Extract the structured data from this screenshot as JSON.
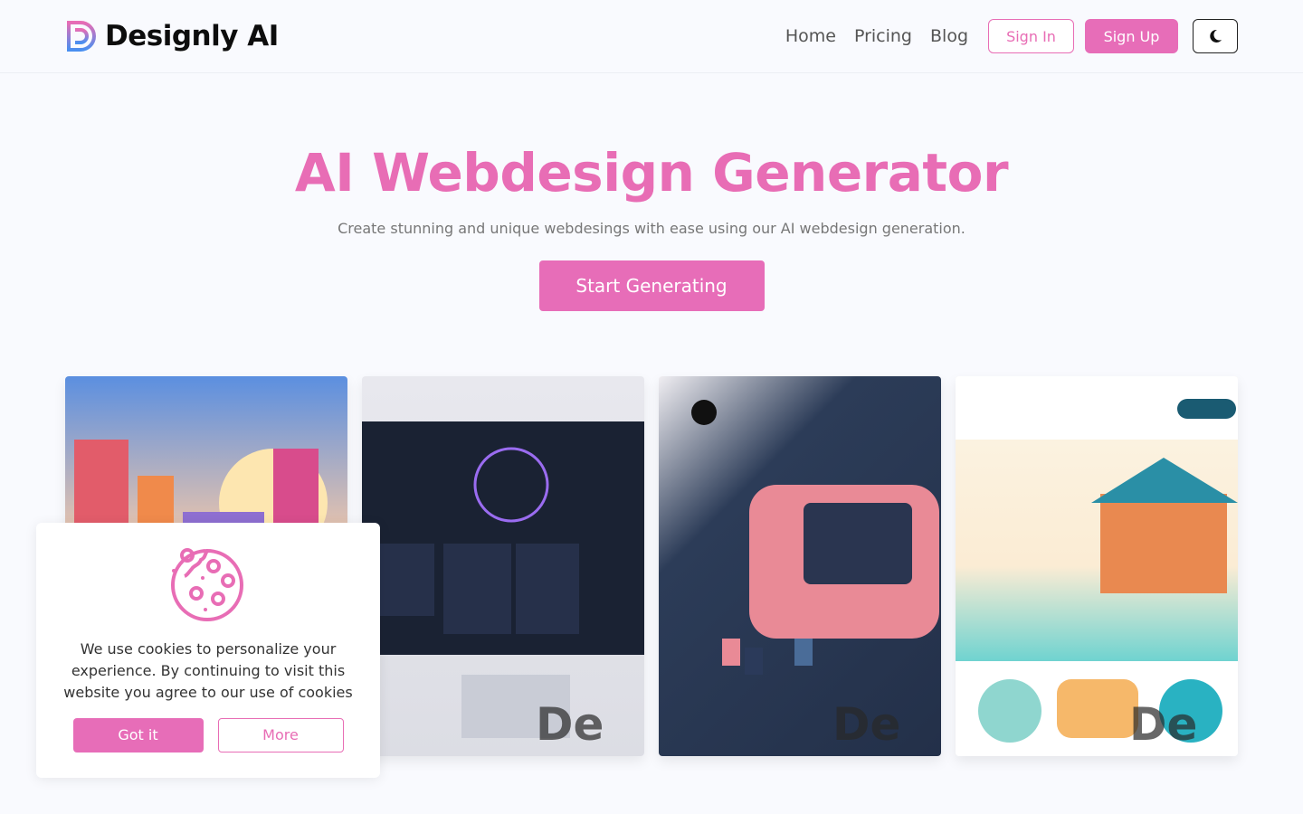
{
  "brand": {
    "name": "Designly AI",
    "accent": "#e76db8"
  },
  "nav": {
    "links": [
      "Home",
      "Pricing",
      "Blog"
    ],
    "sign_in": "Sign In",
    "sign_up": "Sign Up",
    "theme_icon": "moon-icon"
  },
  "hero": {
    "title": "AI Webdesign Generator",
    "subtitle": "Create stunning and unique webdesings with ease using our AI webdesign generation.",
    "cta": "Start Generating"
  },
  "gallery": {
    "watermark": "De"
  },
  "cookie": {
    "icon": "cookie-icon",
    "text": "We use cookies to personalize your experience. By continuing to visit this website you agree to our use of cookies",
    "accept": "Got it",
    "more": "More"
  }
}
